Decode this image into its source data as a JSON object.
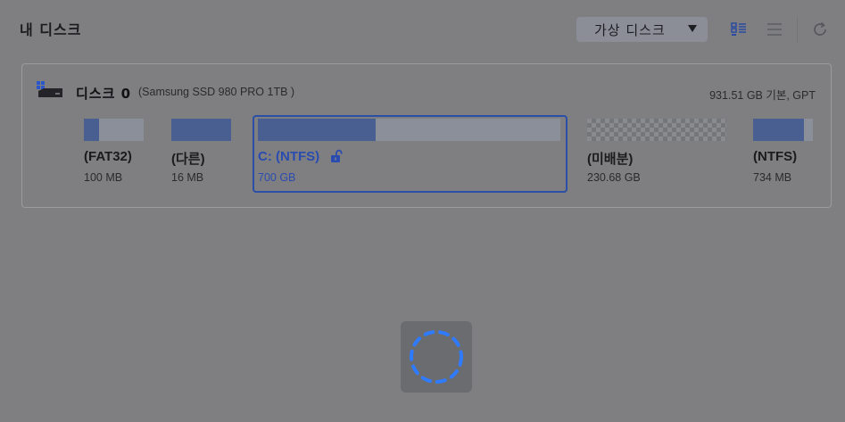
{
  "header": {
    "title": "내 디스크",
    "view_select": {
      "selected": "가상 디스크"
    },
    "tools": [
      "grid-view-icon",
      "list-view-icon",
      "refresh-icon"
    ]
  },
  "disk": {
    "label": "디스크 0",
    "model": "(Samsung SSD 980 PRO 1TB )",
    "summary": "931.51 GB 기본, GPT",
    "partitions": [
      {
        "name": "(FAT32)",
        "size": "100 MB",
        "used_fraction": 0.25
      },
      {
        "name": "(다른)",
        "size": "16 MB",
        "used_fraction": 1.0
      },
      {
        "name": "C: (NTFS)",
        "size": "700 GB",
        "used_fraction": 0.39,
        "selected": true,
        "lock": "unlock-icon"
      },
      {
        "name": "(미배분)",
        "size": "230.68 GB",
        "used_fraction": 0,
        "unallocated": true
      },
      {
        "name": "(NTFS)",
        "size": "734 MB",
        "used_fraction": 0.85
      }
    ]
  },
  "overlay": {
    "state": "loading",
    "icon": "loading-spinner-icon"
  },
  "colors": {
    "backdrop": "#7f7f81",
    "bar_fill": "#4a5f91",
    "bar_track": "#8b8f9a",
    "selection": "#2b4fa6",
    "spinner": "#2f7bff"
  }
}
